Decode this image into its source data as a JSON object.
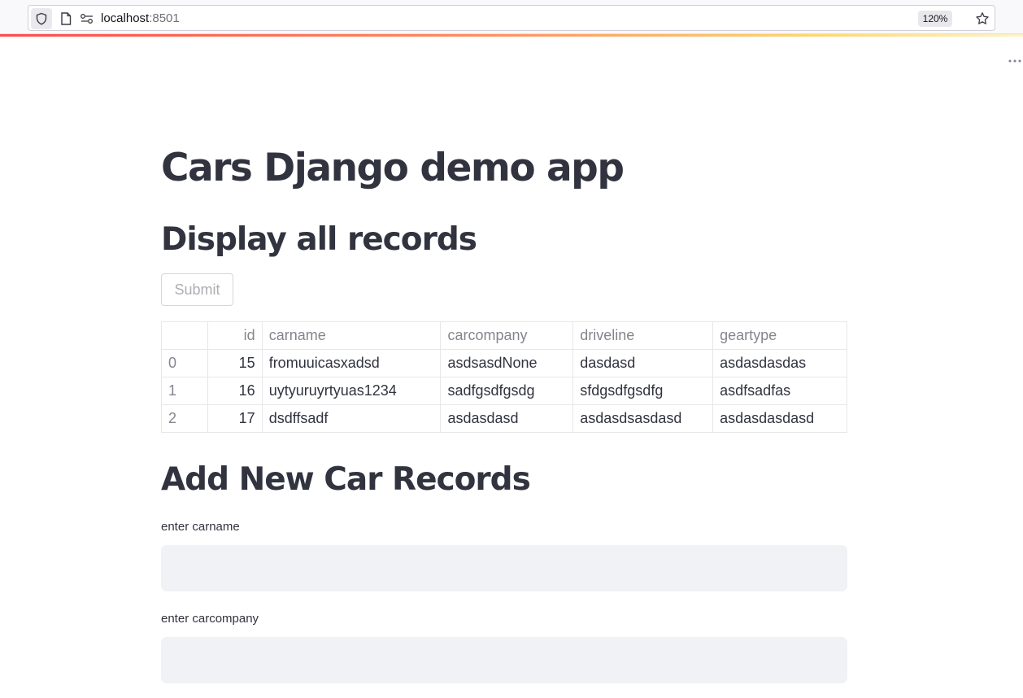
{
  "browser": {
    "url_host": "localhost",
    "url_port": ":8501",
    "zoom": "120%"
  },
  "page": {
    "title": "Cars Django demo app",
    "display_section_title": "Display all records",
    "submit_label": "Submit",
    "add_section_title": "Add New Car Records"
  },
  "table": {
    "headers": [
      "",
      "id",
      "carname",
      "carcompany",
      "driveline",
      "geartype"
    ],
    "rows": [
      {
        "index": "0",
        "id": "15",
        "carname": "fromuuicasxadsd",
        "carcompany": "asdsasdNone",
        "driveline": "dasdasd",
        "geartype": "asdasdasdas"
      },
      {
        "index": "1",
        "id": "16",
        "carname": "uytyuruyrtyuas1234",
        "carcompany": "sadfgsdfgsdg",
        "driveline": "sfdgsdfgsdfg",
        "geartype": "asdfsadfas"
      },
      {
        "index": "2",
        "id": "17",
        "carname": "dsdffsadf",
        "carcompany": "asdasdasd",
        "driveline": "asdasdsasdasd",
        "geartype": "asdasdasdasd"
      }
    ]
  },
  "form": {
    "carname_label": "enter carname",
    "carname_value": "",
    "carcompany_label": "enter carcompany",
    "carcompany_value": ""
  },
  "icons": {
    "shield": "shield-icon",
    "page": "page-icon",
    "site_info": "site-info-icon",
    "star": "star-icon",
    "menu": "menu-icon"
  },
  "colors": {
    "accent": "#ff4b4b",
    "text": "#31333f",
    "input_bg": "#f0f2f6"
  }
}
